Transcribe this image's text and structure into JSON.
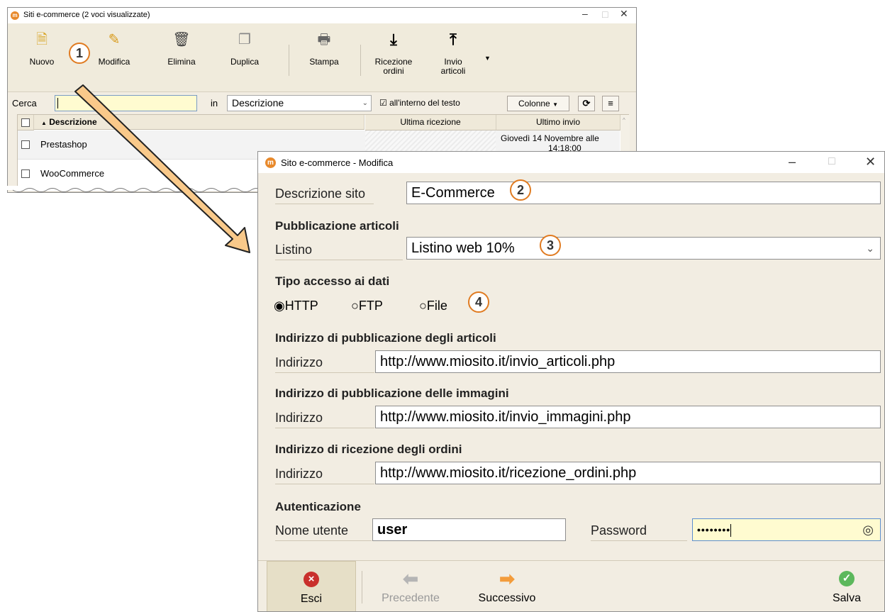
{
  "window_main": {
    "title": "Siti e-commerce (2 voci visualizzate)",
    "toolbar": [
      {
        "label": "Nuovo",
        "icon": "new-document-icon"
      },
      {
        "label": "Modifica",
        "icon": "pencil-icon"
      },
      {
        "label": "Elimina",
        "icon": "trash-icon"
      },
      {
        "label": "Duplica",
        "icon": "copy-icon"
      },
      {
        "label": "Stampa",
        "icon": "printer-icon"
      },
      {
        "label_line1": "Ricezione",
        "label_line2": "ordini",
        "icon": "download-arrow-icon"
      },
      {
        "label_line1": "Invio",
        "label_line2": "articoli",
        "icon": "upload-arrow-icon"
      }
    ],
    "search": {
      "label": "Cerca",
      "value": "",
      "in_label": "in",
      "field_select": "Descrizione",
      "in_text_checkbox": "all'interno del testo",
      "columns_button": "Colonne"
    },
    "grid": {
      "columns": [
        "Descrizione",
        "Ultima ricezione",
        "Ultimo invio"
      ],
      "rows": [
        {
          "descrizione": "Prestashop",
          "ultima_ricezione": "",
          "ultimo_invio": "Giovedì 14 Novembre alle",
          "ultimo_invio_cut": "14:18:00"
        },
        {
          "descrizione": "WooCommerce",
          "ultima_ricezione": "",
          "ultimo_invio": ""
        }
      ]
    }
  },
  "dialog": {
    "title": "Sito e-commerce - Modifica",
    "descrizione_label": "Descrizione sito",
    "descrizione_value": "E-Commerce",
    "pubblicazione_heading": "Pubblicazione articoli",
    "listino_label": "Listino",
    "listino_value": "Listino web 10%",
    "accesso_heading": "Tipo accesso ai dati",
    "access_options": [
      "HTTP",
      "FTP",
      "File"
    ],
    "access_selected": "HTTP",
    "articoli_heading": "Indirizzo di pubblicazione degli articoli",
    "articoli_label": "Indirizzo",
    "articoli_value": "http://www.miosito.it/invio_articoli.php",
    "immagini_heading": "Indirizzo di pubblicazione delle immagini",
    "immagini_label": "Indirizzo",
    "immagini_value": "http://www.miosito.it/invio_immagini.php",
    "ordini_heading": "Indirizzo di ricezione degli ordini",
    "ordini_label": "Indirizzo",
    "ordini_value": "http://www.miosito.it/ricezione_ordini.php",
    "auth_heading": "Autenticazione",
    "user_label": "Nome utente",
    "user_value": "user",
    "password_label": "Password",
    "password_value": "••••••••",
    "buttons": {
      "esci": "Esci",
      "precedente": "Precedente",
      "successivo": "Successivo",
      "salva": "Salva"
    }
  },
  "callouts": [
    "1",
    "2",
    "3",
    "4"
  ],
  "colors": {
    "callout": "#e07b21",
    "search_bg": "#fffbd0",
    "salva": "#5cb85c",
    "esci": "#c9302c",
    "arrow": "#f39c3b"
  }
}
